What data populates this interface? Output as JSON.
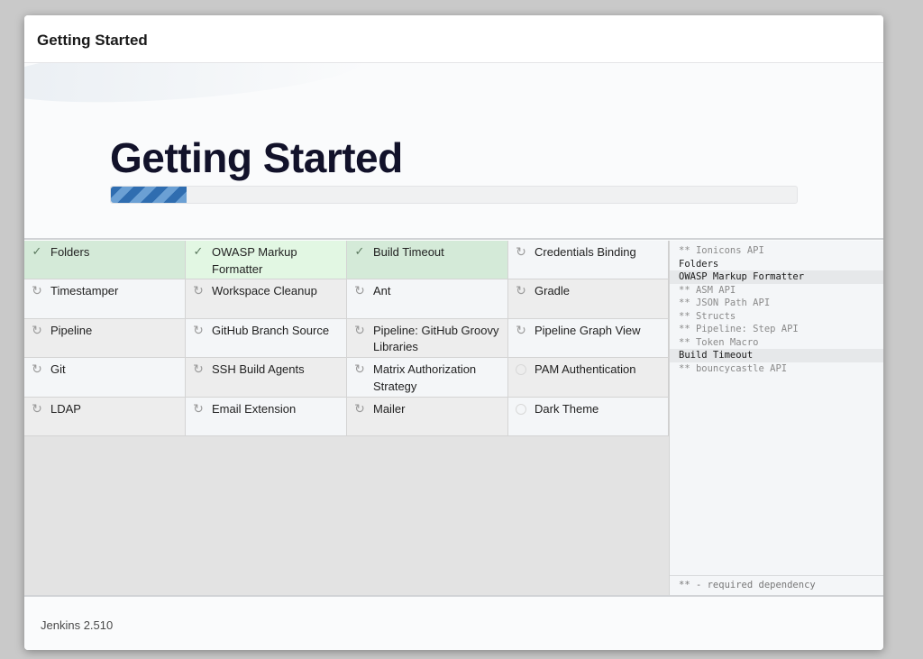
{
  "header": {
    "title": "Getting Started"
  },
  "hero": {
    "title": "Getting Started",
    "progress": 0.11
  },
  "plugins": [
    {
      "name": "Folders",
      "status": "success",
      "icon": "check-icon"
    },
    {
      "name": "OWASP Markup Formatter",
      "status": "active",
      "icon": "check-icon"
    },
    {
      "name": "Build Timeout",
      "status": "success",
      "icon": "check-icon"
    },
    {
      "name": "Credentials Binding",
      "status": "pending",
      "icon": "refresh-icon"
    },
    {
      "name": "Timestamper",
      "status": "pending",
      "icon": "refresh-icon"
    },
    {
      "name": "Workspace Cleanup",
      "status": "pending",
      "icon": "refresh-icon"
    },
    {
      "name": "Ant",
      "status": "pending",
      "icon": "refresh-icon"
    },
    {
      "name": "Gradle",
      "status": "pending",
      "icon": "refresh-icon"
    },
    {
      "name": "Pipeline",
      "status": "pending",
      "icon": "refresh-icon"
    },
    {
      "name": "GitHub Branch Source",
      "status": "pending",
      "icon": "refresh-icon"
    },
    {
      "name": "Pipeline: GitHub Groovy Libraries",
      "status": "pending",
      "icon": "refresh-icon"
    },
    {
      "name": "Pipeline Graph View",
      "status": "pending",
      "icon": "refresh-icon"
    },
    {
      "name": "Git",
      "status": "pending",
      "icon": "refresh-icon"
    },
    {
      "name": "SSH Build Agents",
      "status": "pending",
      "icon": "refresh-icon"
    },
    {
      "name": "Matrix Authorization Strategy",
      "status": "pending",
      "icon": "refresh-icon"
    },
    {
      "name": "PAM Authentication",
      "status": "pending",
      "icon": "circle-icon"
    },
    {
      "name": "LDAP",
      "status": "pending",
      "icon": "refresh-icon"
    },
    {
      "name": "Email Extension",
      "status": "pending",
      "icon": "refresh-icon"
    },
    {
      "name": "Mailer",
      "status": "pending",
      "icon": "refresh-icon"
    },
    {
      "name": "Dark Theme",
      "status": "pending",
      "icon": "circle-icon"
    }
  ],
  "log": {
    "lines": [
      {
        "text": "** Ionicons API",
        "type": "dependency"
      },
      {
        "text": "Folders",
        "type": "installed"
      },
      {
        "text": "OWASP Markup Formatter",
        "type": "active"
      },
      {
        "text": "** ASM API",
        "type": "dependency"
      },
      {
        "text": "** JSON Path API",
        "type": "dependency"
      },
      {
        "text": "** Structs",
        "type": "dependency"
      },
      {
        "text": "** Pipeline: Step API",
        "type": "dependency"
      },
      {
        "text": "** Token Macro",
        "type": "dependency"
      },
      {
        "text": "Build Timeout",
        "type": "active"
      },
      {
        "text": "** bouncycastle API",
        "type": "dependency"
      }
    ],
    "footer": "** - required dependency"
  },
  "footer": {
    "version": "Jenkins 2.510"
  },
  "colors": {
    "accent": "#3b7cc0",
    "success_bg": "#d4ead8",
    "active_bg": "#e2f7e3"
  }
}
